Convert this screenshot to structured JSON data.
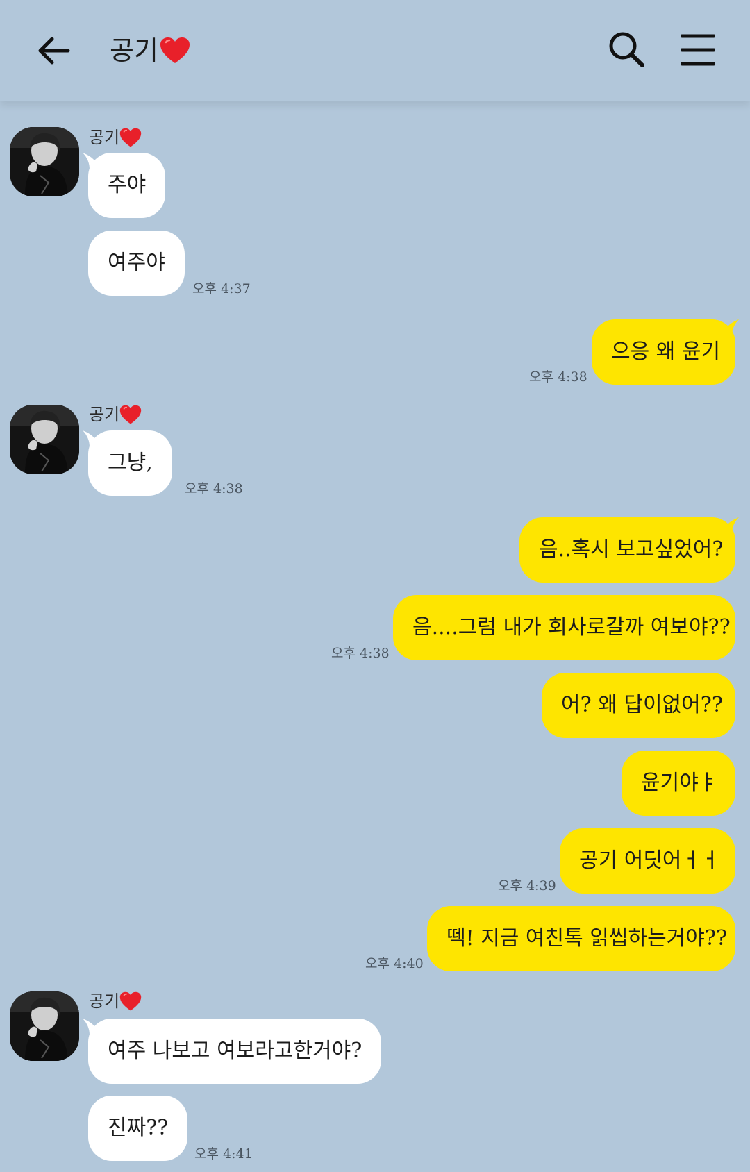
{
  "header": {
    "title": "공기",
    "back_icon": "arrow-left-icon",
    "search_icon": "search-icon",
    "menu_icon": "hamburger-menu-icon"
  },
  "colors": {
    "background": "#b2c7da",
    "incoming_bubble": "#ffffff",
    "outgoing_bubble": "#fee500",
    "heart": "#e8202a"
  },
  "messages": [
    {
      "sender": "공기",
      "text": "주야"
    },
    {
      "text": "여주야",
      "time": "오후 4:37"
    },
    {
      "text": "으응 왜 윤기",
      "time": "오후 4:38"
    },
    {
      "sender": "공기",
      "text": "그냥,",
      "time": "오후 4:38"
    },
    {
      "text": "음..혹시 보고싶었어?"
    },
    {
      "text": "음....그럼 내가 회사로갈까 여보야??",
      "time": "오후 4:38"
    },
    {
      "text": "어? 왜 답이없어??"
    },
    {
      "text": "윤기야ㅑ"
    },
    {
      "text": "공기 어딧어ㅓㅓ",
      "time": "오후 4:39"
    },
    {
      "text": "떽! 지금 여친톡 읽씹하는거야??",
      "time": "오후 4:40"
    },
    {
      "sender": "공기",
      "text": "여주 나보고 여보라고한거야?"
    },
    {
      "text": "진짜??",
      "time": "오후 4:41"
    }
  ]
}
